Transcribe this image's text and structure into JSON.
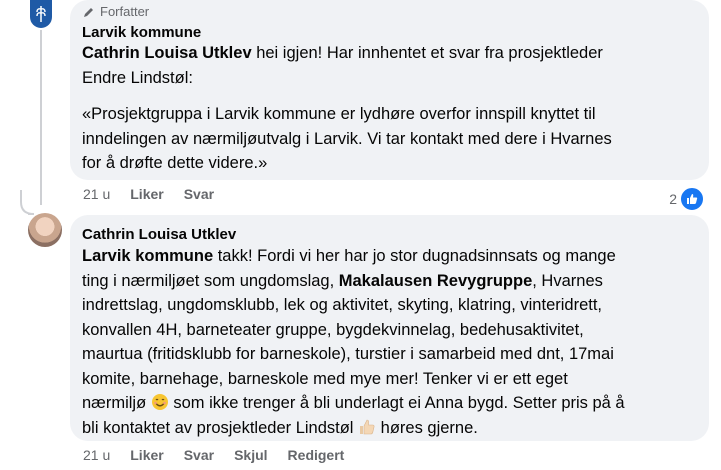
{
  "comment1": {
    "badge": "Forfatter",
    "author": "Larvik kommune",
    "mention": "Cathrin Louisa Utklev",
    "text_after_mention": " hei igjen! Har innhentet et svar fra prosjektleder",
    "line2": "Endre Lindstøl:",
    "quote_line1": "«Prosjektgruppa i Larvik kommune er lydhøre overfor innspill knyttet til",
    "quote_line2": "inndelingen av nærmiljøutvalg i Larvik. Vi tar kontakt med dere i Hvarnes",
    "quote_line3": "for å drøfte dette videre.»",
    "time": "21 u",
    "like": "Liker",
    "reply": "Svar",
    "reaction_count": "2"
  },
  "comment2": {
    "author": "Cathrin Louisa Utklev",
    "mention": "Larvik kommune",
    "l1_rest": " takk! Fordi vi her har jo stor dugnadsinnsats og mange",
    "l2_start": "ting i nærmiljøet som ungdomslag, ",
    "l2_mention": "Makalausen Revygruppe",
    "l2_end": ", Hvarnes",
    "l3": "indrettslag, ungdomsklubb, lek og aktivitet, skyting, klatring, vinteridrett,",
    "l4": "konvallen 4H, barneteater gruppe, bygdekvinnelag, bedehusaktivitet,",
    "l5": "maurtua (fritidsklubb for barneskole), turstier i samarbeid med dnt, 17mai",
    "l6": "komite, barnehage, barneskole med mye mer! Tenker vi er ett eget",
    "l7_start": "nærmiljø",
    "l7_end": " som ikke trenger å bli underlagt ei Anna bygd. Setter pris på å",
    "l8_start": "bli kontaktet av prosjektleder Lindstøl",
    "l8_end": " høres gjerne.",
    "time": "21 u",
    "like": "Liker",
    "reply": "Svar",
    "hide": "Skjul",
    "edited": "Redigert"
  },
  "icons": {
    "logo": "larvik-coat-of-arms-icon",
    "badge": "pencil-icon",
    "like": "thumbs-up-icon",
    "smile": "smiling-face-emoji",
    "thumb": "thumbs-up-emoji"
  },
  "colors": {
    "bubble": "#f0f2f5",
    "meta": "#65676b",
    "like_blue": "#1877f2",
    "logo_blue": "#1f5aa6"
  }
}
